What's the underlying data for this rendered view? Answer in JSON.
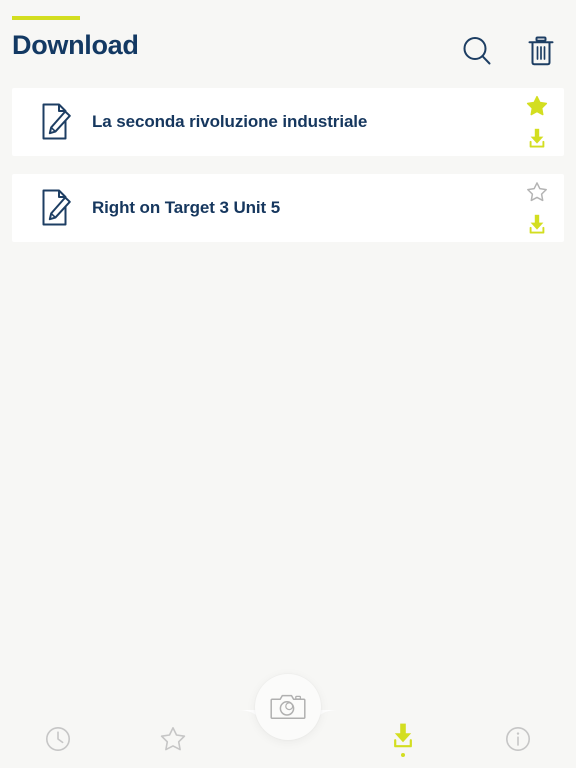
{
  "header": {
    "title": "Download",
    "accent_color": "#d3de20",
    "title_color": "#133963",
    "search_icon": "search-icon",
    "delete_icon": "trash-icon"
  },
  "list": {
    "items": [
      {
        "title": "La seconda rivoluzione industriale",
        "doc_icon": "document-edit-icon",
        "starred": true,
        "star_icon": "star-filled-icon",
        "download_icon": "download-icon"
      },
      {
        "title": "Right on Target 3 Unit 5",
        "doc_icon": "document-edit-icon",
        "starred": false,
        "star_icon": "star-outline-icon",
        "download_icon": "download-icon"
      }
    ]
  },
  "bottom_nav": {
    "active": "download",
    "camera_label": "camera-icon",
    "items": [
      {
        "id": "history",
        "icon": "clock-icon",
        "active": false
      },
      {
        "id": "favorites",
        "icon": "star-icon",
        "active": false
      },
      {
        "id": "camera",
        "icon": "camera-icon",
        "active": false
      },
      {
        "id": "download",
        "icon": "download-icon",
        "active": true
      },
      {
        "id": "info",
        "icon": "info-icon",
        "active": false
      }
    ]
  },
  "colors": {
    "accent": "#d3de20",
    "navy": "#16375e",
    "background": "#f7f7f5",
    "card": "#ffffff",
    "inactive": "#c9c9c9"
  }
}
